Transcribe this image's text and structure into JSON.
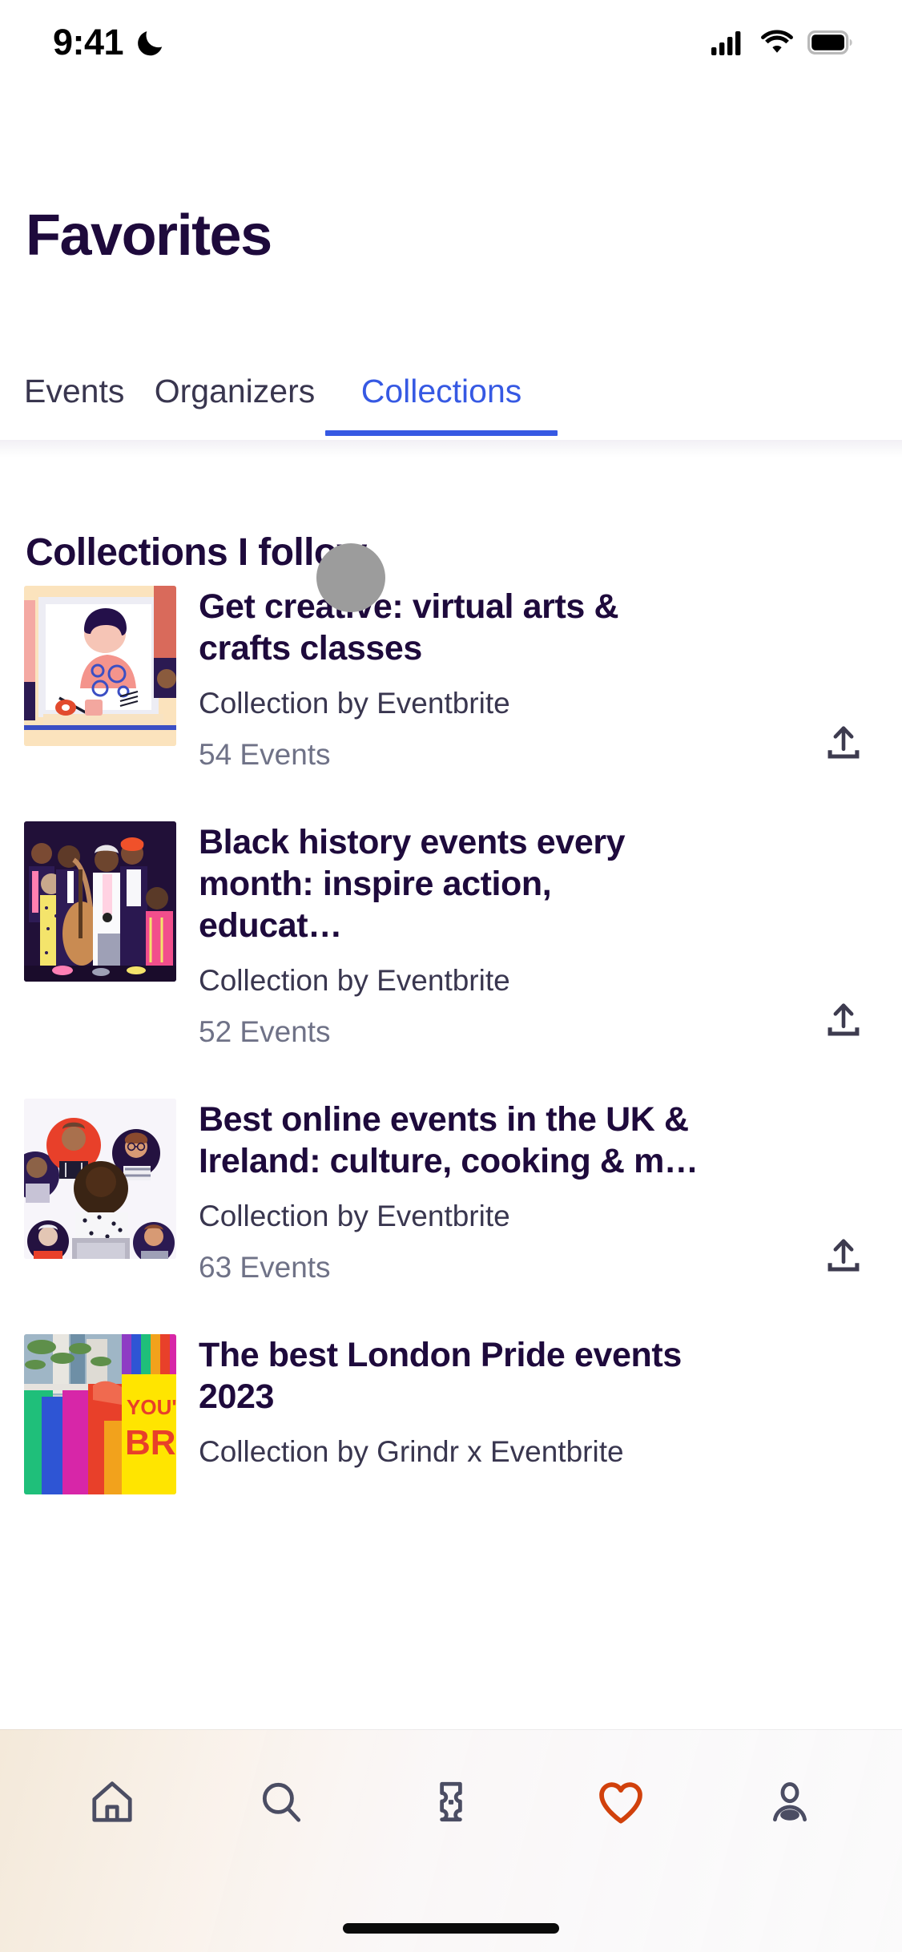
{
  "status_bar": {
    "time": "9:41",
    "icons": [
      "moon-icon",
      "cellular-signal-icon",
      "wifi-icon",
      "battery-icon"
    ]
  },
  "header": {
    "title": "Favorites"
  },
  "tabs": {
    "items": [
      {
        "label": "Events",
        "active": false
      },
      {
        "label": "Organizers",
        "active": false
      },
      {
        "label": "Collections",
        "active": true
      }
    ],
    "active_color": "#3659E3",
    "inactive_color": "#39364F"
  },
  "main": {
    "section_title": "Collections I follow",
    "collections": [
      {
        "title": "Get creative: virtual arts & crafts classes",
        "byline": "Collection by Eventbrite",
        "count": "54 Events",
        "share_label": "share-icon"
      },
      {
        "title": "Black history events every month: inspire action, educat…",
        "byline": "Collection by Eventbrite",
        "count": "52 Events",
        "share_label": "share-icon"
      },
      {
        "title": "Best online events in the UK & Ireland: culture, cooking & m…",
        "byline": "Collection by Eventbrite",
        "count": "63 Events",
        "share_label": "share-icon"
      },
      {
        "title": "The best London Pride events 2023",
        "byline": "Collection by Grindr x Eventbrite",
        "count": "",
        "share_label": "share-icon"
      }
    ]
  },
  "bottom_nav": {
    "items": [
      {
        "name": "home",
        "icon": "home-icon",
        "active": false
      },
      {
        "name": "search",
        "icon": "search-icon",
        "active": false
      },
      {
        "name": "tickets",
        "icon": "ticket-icon",
        "active": false
      },
      {
        "name": "favorites",
        "icon": "heart-icon",
        "active": true
      },
      {
        "name": "profile",
        "icon": "person-icon",
        "active": false
      }
    ],
    "active_color": "#D1410C",
    "inactive_color": "#4B4D63"
  },
  "cursor": {
    "visible": true,
    "color": "#9C9C9C"
  }
}
